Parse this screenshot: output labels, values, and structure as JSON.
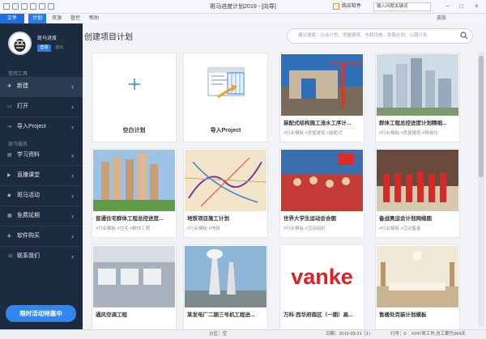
{
  "titlebar": {
    "title": "斑马进度计划2019 - [向导]",
    "buy_label": "购买软件",
    "search_placeholder": "输入问题关键词",
    "theme": "皮肤"
  },
  "menus": [
    "文件",
    "计划",
    "资源",
    "管控",
    "帮助"
  ],
  "window_buttons": {
    "minimize": "–",
    "maximize": "□",
    "close": "×"
  },
  "sidebar": {
    "user_name": "斑马进度",
    "sign_in": "登录",
    "logout": "退出",
    "sections": {
      "tools": "常用工具",
      "services": "斑马服务"
    },
    "tool_items": [
      {
        "label": "新建",
        "icon": "new-icon"
      },
      {
        "label": "打开",
        "icon": "folder-icon"
      },
      {
        "label": "导入Project",
        "icon": "import-icon"
      }
    ],
    "service_items": [
      {
        "label": "学习资料",
        "icon": "book-icon"
      },
      {
        "label": "直播课堂",
        "icon": "live-icon"
      },
      {
        "label": "斑马活动",
        "icon": "activity-icon"
      },
      {
        "label": "免费延期",
        "icon": "calendar-icon"
      },
      {
        "label": "软件购买",
        "icon": "cart-icon"
      },
      {
        "label": "联系我们",
        "icon": "contact-icon"
      }
    ],
    "promo": "限时活动特惠中"
  },
  "main": {
    "title": "创建项目计划",
    "search_placeholder": "建议搜索：企业计划、房屋建筑、市政设施、铁路计划、公路计划"
  },
  "cards": [
    {
      "title": "空白计划",
      "tags": ""
    },
    {
      "title": "导入Project",
      "tags": ""
    },
    {
      "title": "装配式结构施工流水工序计...",
      "tags": "#行业模板 #房屋建筑 #装配式"
    },
    {
      "title": "群体工程总控进度计划精细...",
      "tags": "#行业模板 #房屋建筑 #精细化"
    },
    {
      "title": "普通住宅群体工程总控进度...",
      "tags": "#行业模板 #住宅 #群体工程"
    },
    {
      "title": "地铁项目施工计划",
      "tags": "#行业模板 #地铁"
    },
    {
      "title": "世界大学生运动会合图",
      "tags": "#行业模板 #活动组织"
    },
    {
      "title": "备战奥运会计划网络图",
      "tags": "#行业模板 #活动备备"
    },
    {
      "title": "通风空调工程",
      "tags": ""
    },
    {
      "title": "某发电厂二期三号机工程进...",
      "tags": ""
    },
    {
      "title": "万科·西华府南区（一期）高...",
      "tags": ""
    },
    {
      "title": "售楼处完装计划模板",
      "tags": ""
    }
  ],
  "vanke_logo": "vanke",
  "status": {
    "zoom": "分区：空",
    "date": "日期：2019-03-21（1）",
    "row": "行号：0",
    "workdays": "#247项工作,总工期为364天"
  },
  "colors": {
    "accent": "#1e6fd9",
    "sidebar": "#1d2b3e",
    "promo": "#2f86f0",
    "vanke_red": "#e21e25"
  }
}
